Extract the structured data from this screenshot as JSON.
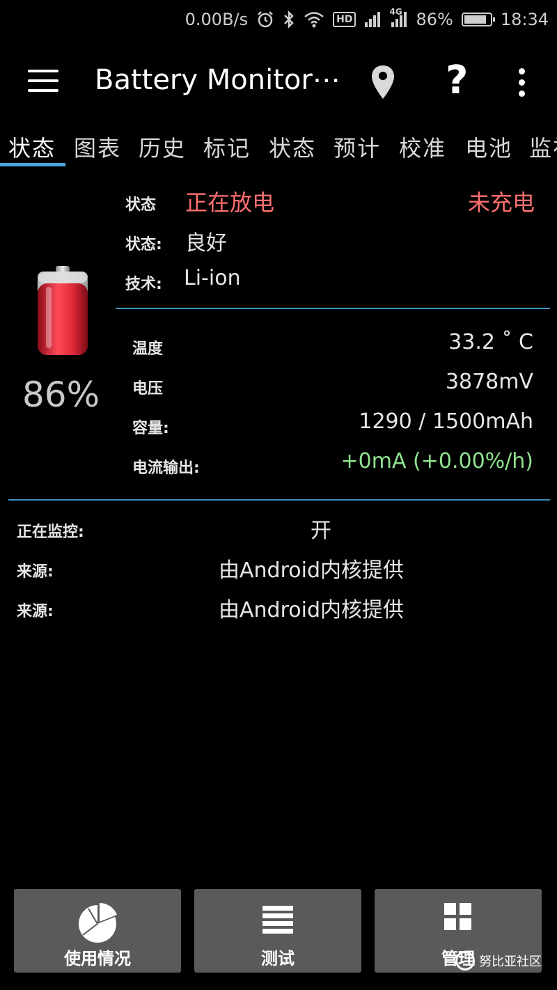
{
  "statusbar": {
    "net_speed": "0.00B/s",
    "hd_label": "HD",
    "net_type": "4G",
    "battery_percent": "86%",
    "battery_level": 0.86,
    "time": "18:34"
  },
  "appbar": {
    "title": "Battery Monitor⋯"
  },
  "tabs": [
    "状态",
    "图表",
    "历史",
    "标记",
    "状态",
    "预计",
    "校准",
    "电池",
    "监视"
  ],
  "battery": {
    "percent": "86%",
    "level": 0.86,
    "fill_color": "#e02a3a"
  },
  "status": {
    "state_label": "状态",
    "state_value": "正在放电",
    "charge_state": "未充电",
    "health_label": "状态:",
    "health_value": "良好",
    "tech_label": "技术:",
    "tech_value": "Li-ion"
  },
  "metrics": {
    "temp_label": "温度",
    "temp_value": "33.2 ˚ C",
    "voltage_label": "电压",
    "voltage_value": "3878mV",
    "capacity_label": "容量:",
    "capacity_value": "1290 / 1500mAh",
    "current_label": "电流输出:",
    "current_value": "+0mA (+0.00%/h)"
  },
  "monitor": {
    "monitoring_label": "正在监控:",
    "monitoring_value": "开",
    "source_label_1": "来源:",
    "source_value_1": "由Android内核提供",
    "source_label_2": "来源:",
    "source_value_2": "由Android内核提供"
  },
  "bottom": {
    "usage_label": "使用情况",
    "test_label": "测试",
    "manage_label": "管理"
  },
  "watermark": "努比亚社区",
  "colors": {
    "accent": "#3e8fbf",
    "discharging": "#ff6f6f",
    "current": "#8fe28f",
    "button_bg": "#5a5a5a"
  }
}
